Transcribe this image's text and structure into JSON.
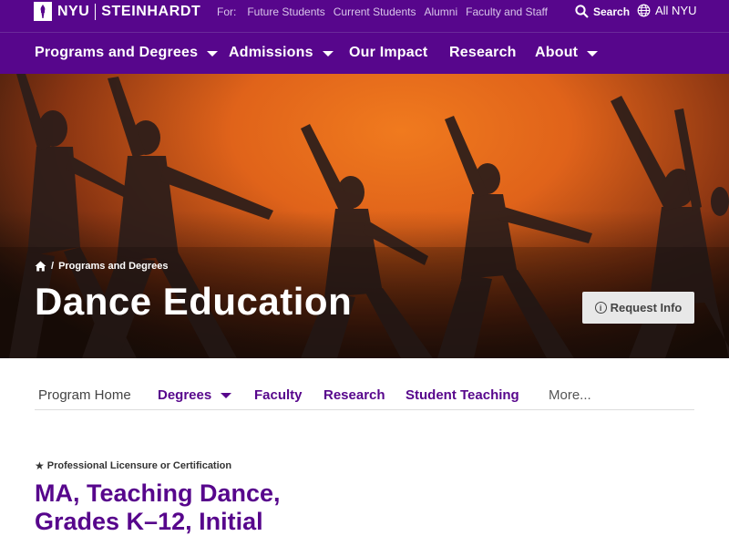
{
  "brand": {
    "university": "NYU",
    "school": "STEINHARDT",
    "purple": "#57068c"
  },
  "utility": {
    "for_label": "For:",
    "links": [
      "Future Students",
      "Current Students",
      "Alumni",
      "Faculty and Staff"
    ],
    "search_label": "Search",
    "all_nyu_label": "All NYU"
  },
  "nav": {
    "items": [
      {
        "label": "Programs and Degrees",
        "has_dropdown": true
      },
      {
        "label": "Admissions",
        "has_dropdown": true
      },
      {
        "label": "Our Impact",
        "has_dropdown": false
      },
      {
        "label": "Research",
        "has_dropdown": false
      },
      {
        "label": "About",
        "has_dropdown": true
      }
    ]
  },
  "hero": {
    "breadcrumb": {
      "home_icon": "home-icon",
      "separator": "/",
      "current": "Programs and Degrees"
    },
    "title": "Dance Education",
    "request_info_label": "Request Info"
  },
  "program_nav": {
    "items": [
      "Program Home",
      "Degrees",
      "Faculty",
      "Research",
      "Student Teaching",
      "More..."
    ]
  },
  "degree": {
    "badge_icon": "star-icon",
    "badge_label": "Professional Licensure or Certification",
    "title": "MA, Teaching Dance, Grades K–12, Initial"
  }
}
